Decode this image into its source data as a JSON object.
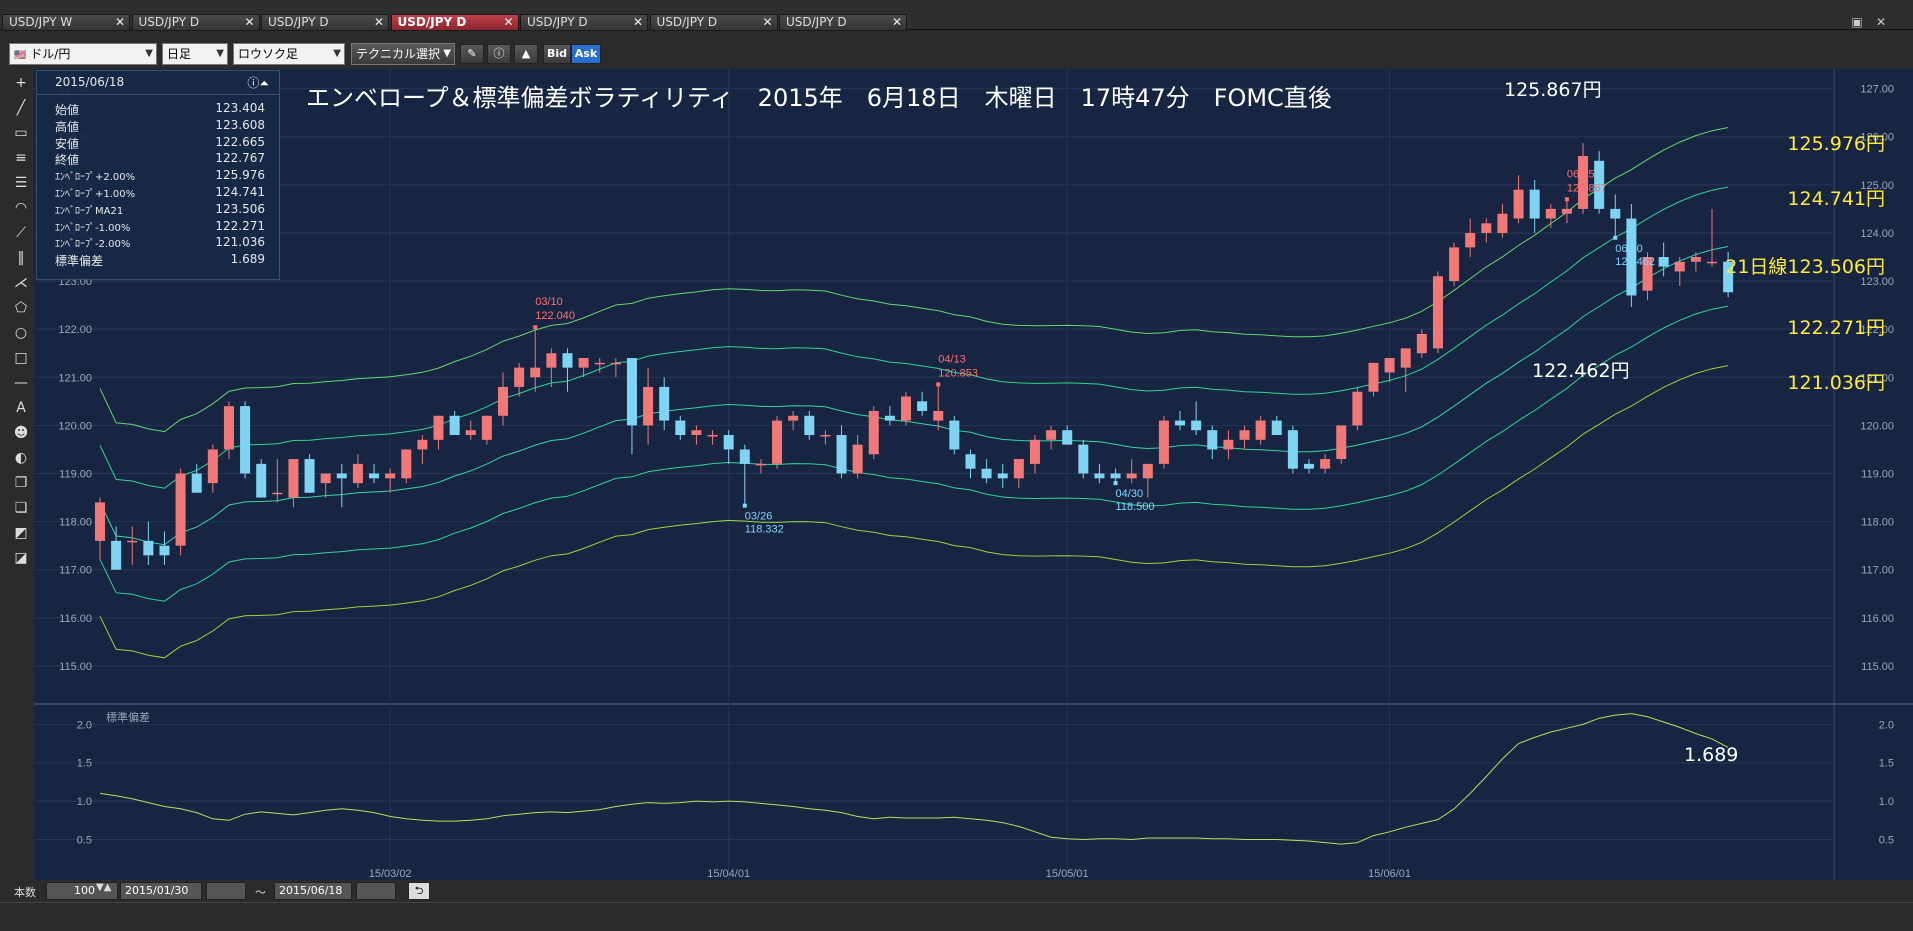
{
  "tabs": [
    {
      "label": "USD/JPY W",
      "active": false
    },
    {
      "label": "USD/JPY D",
      "active": false
    },
    {
      "label": "USD/JPY D",
      "active": false
    },
    {
      "label": "USD/JPY D",
      "active": true
    },
    {
      "label": "USD/JPY D",
      "active": false
    },
    {
      "label": "USD/JPY D",
      "active": false
    },
    {
      "label": "USD/JPY D",
      "active": false
    }
  ],
  "toolbar": {
    "pair": "ドル/円",
    "period": "日足",
    "chart_type": "ロウソク足",
    "technical": "テクニカル選択",
    "bid": "Bid",
    "ask": "Ask"
  },
  "infobox": {
    "date": "2015/06/18",
    "rows": [
      {
        "label": "始値",
        "value": "123.404"
      },
      {
        "label": "高値",
        "value": "123.608"
      },
      {
        "label": "安値",
        "value": "122.665"
      },
      {
        "label": "終値",
        "value": "122.767"
      },
      {
        "label": "ｴﾝﾍﾞﾛｰﾌﾟ+2.00%",
        "value": "125.976"
      },
      {
        "label": "ｴﾝﾍﾞﾛｰﾌﾟ+1.00%",
        "value": "124.741"
      },
      {
        "label": "ｴﾝﾍﾞﾛｰﾌﾟMA21",
        "value": "123.506"
      },
      {
        "label": "ｴﾝﾍﾞﾛｰﾌﾟ-1.00%",
        "value": "122.271"
      },
      {
        "label": "ｴﾝﾍﾞﾛｰﾌﾟ-2.00%",
        "value": "121.036"
      },
      {
        "label": "標準偏差",
        "value": "1.689"
      }
    ]
  },
  "chart_data": {
    "type": "candlestick",
    "title": "エンベロープ＆標準偏差ボラティリティ　2015年　6月18日　木曜日　17時47分　FOMC直後",
    "y_ticks": [
      "127.00",
      "126.00",
      "125.00",
      "124.00",
      "123.00",
      "122.00",
      "121.00",
      "120.00",
      "119.00",
      "118.00",
      "117.00",
      "116.00",
      "115.00"
    ],
    "ylim": [
      114.5,
      127.2
    ],
    "x_date_labels": [
      {
        "label": "15/03/02",
        "index": 18
      },
      {
        "label": "15/04/01",
        "index": 39
      },
      {
        "label": "15/05/01",
        "index": 60
      },
      {
        "label": "15/06/01",
        "index": 80
      }
    ],
    "candles": [
      {
        "o": 117.6,
        "h": 118.5,
        "l": 117.2,
        "c": 118.4
      },
      {
        "o": 117.6,
        "h": 117.9,
        "l": 117.0,
        "c": 117.0
      },
      {
        "o": 117.6,
        "h": 117.9,
        "l": 117.1,
        "c": 117.6
      },
      {
        "o": 117.6,
        "h": 118.0,
        "l": 117.1,
        "c": 117.3
      },
      {
        "o": 117.5,
        "h": 117.8,
        "l": 117.1,
        "c": 117.3
      },
      {
        "o": 117.5,
        "h": 119.1,
        "l": 117.3,
        "c": 119.0
      },
      {
        "o": 119.0,
        "h": 119.2,
        "l": 118.6,
        "c": 118.6
      },
      {
        "o": 118.8,
        "h": 119.6,
        "l": 118.6,
        "c": 119.5
      },
      {
        "o": 119.5,
        "h": 120.5,
        "l": 119.3,
        "c": 120.4
      },
      {
        "o": 120.4,
        "h": 120.5,
        "l": 118.9,
        "c": 119.0
      },
      {
        "o": 119.2,
        "h": 119.3,
        "l": 118.5,
        "c": 118.5
      },
      {
        "o": 118.6,
        "h": 119.3,
        "l": 118.4,
        "c": 118.6
      },
      {
        "o": 118.5,
        "h": 119.3,
        "l": 118.3,
        "c": 119.3
      },
      {
        "o": 119.3,
        "h": 119.4,
        "l": 118.6,
        "c": 118.6
      },
      {
        "o": 118.8,
        "h": 119.0,
        "l": 118.5,
        "c": 119.0
      },
      {
        "o": 119.0,
        "h": 119.2,
        "l": 118.3,
        "c": 118.9
      },
      {
        "o": 118.8,
        "h": 119.4,
        "l": 118.7,
        "c": 119.2
      },
      {
        "o": 119.0,
        "h": 119.2,
        "l": 118.8,
        "c": 118.9
      },
      {
        "o": 118.9,
        "h": 119.1,
        "l": 118.6,
        "c": 119.0
      },
      {
        "o": 118.9,
        "h": 119.5,
        "l": 118.8,
        "c": 119.5
      },
      {
        "o": 119.5,
        "h": 119.8,
        "l": 119.2,
        "c": 119.7
      },
      {
        "o": 119.7,
        "h": 120.2,
        "l": 119.5,
        "c": 120.2
      },
      {
        "o": 120.2,
        "h": 120.3,
        "l": 119.8,
        "c": 119.8
      },
      {
        "o": 119.8,
        "h": 120.1,
        "l": 119.7,
        "c": 119.9
      },
      {
        "o": 119.7,
        "h": 120.2,
        "l": 119.6,
        "c": 120.2
      },
      {
        "o": 120.2,
        "h": 121.1,
        "l": 120.0,
        "c": 120.8
      },
      {
        "o": 120.8,
        "h": 121.3,
        "l": 120.6,
        "c": 121.2
      },
      {
        "o": 121.0,
        "h": 122.04,
        "l": 120.7,
        "c": 121.2
      },
      {
        "o": 121.2,
        "h": 121.6,
        "l": 120.8,
        "c": 121.5
      },
      {
        "o": 121.5,
        "h": 121.6,
        "l": 120.7,
        "c": 121.2
      },
      {
        "o": 121.2,
        "h": 121.4,
        "l": 121.0,
        "c": 121.4
      },
      {
        "o": 121.3,
        "h": 121.4,
        "l": 121.1,
        "c": 121.3
      },
      {
        "o": 121.3,
        "h": 121.4,
        "l": 121.0,
        "c": 121.3
      },
      {
        "o": 121.4,
        "h": 121.4,
        "l": 119.4,
        "c": 120.0
      },
      {
        "o": 120.0,
        "h": 121.2,
        "l": 119.6,
        "c": 120.8
      },
      {
        "o": 120.8,
        "h": 121.0,
        "l": 119.9,
        "c": 120.1
      },
      {
        "o": 120.1,
        "h": 120.2,
        "l": 119.7,
        "c": 119.8
      },
      {
        "o": 119.8,
        "h": 120.0,
        "l": 119.6,
        "c": 119.9
      },
      {
        "o": 119.8,
        "h": 119.9,
        "l": 119.6,
        "c": 119.8
      },
      {
        "o": 119.8,
        "h": 119.9,
        "l": 119.2,
        "c": 119.5
      },
      {
        "o": 119.5,
        "h": 119.6,
        "l": 118.332,
        "c": 119.2
      },
      {
        "o": 119.2,
        "h": 119.3,
        "l": 119.0,
        "c": 119.2
      },
      {
        "o": 119.2,
        "h": 120.2,
        "l": 119.1,
        "c": 120.1
      },
      {
        "o": 120.1,
        "h": 120.3,
        "l": 119.9,
        "c": 120.2
      },
      {
        "o": 120.2,
        "h": 120.3,
        "l": 119.7,
        "c": 119.8
      },
      {
        "o": 119.8,
        "h": 119.9,
        "l": 119.6,
        "c": 119.8
      },
      {
        "o": 119.8,
        "h": 120.0,
        "l": 118.9,
        "c": 119.0
      },
      {
        "o": 119.0,
        "h": 119.8,
        "l": 118.9,
        "c": 119.6
      },
      {
        "o": 119.4,
        "h": 120.4,
        "l": 119.3,
        "c": 120.3
      },
      {
        "o": 120.2,
        "h": 120.4,
        "l": 120.0,
        "c": 120.1
      },
      {
        "o": 120.1,
        "h": 120.7,
        "l": 120.0,
        "c": 120.6
      },
      {
        "o": 120.5,
        "h": 120.7,
        "l": 120.2,
        "c": 120.3
      },
      {
        "o": 120.1,
        "h": 120.853,
        "l": 119.9,
        "c": 120.3
      },
      {
        "o": 120.1,
        "h": 120.2,
        "l": 119.4,
        "c": 119.5
      },
      {
        "o": 119.4,
        "h": 119.5,
        "l": 118.9,
        "c": 119.1
      },
      {
        "o": 119.1,
        "h": 119.3,
        "l": 118.8,
        "c": 118.9
      },
      {
        "o": 119.0,
        "h": 119.2,
        "l": 118.7,
        "c": 118.9
      },
      {
        "o": 118.9,
        "h": 119.3,
        "l": 118.7,
        "c": 119.3
      },
      {
        "o": 119.2,
        "h": 119.8,
        "l": 119.0,
        "c": 119.7
      },
      {
        "o": 119.7,
        "h": 120.0,
        "l": 119.5,
        "c": 119.9
      },
      {
        "o": 119.9,
        "h": 120.0,
        "l": 119.6,
        "c": 119.6
      },
      {
        "o": 119.6,
        "h": 119.7,
        "l": 118.9,
        "c": 119.0
      },
      {
        "o": 119.0,
        "h": 119.2,
        "l": 118.8,
        "c": 118.9
      },
      {
        "o": 119.0,
        "h": 119.1,
        "l": 118.8,
        "c": 118.9
      },
      {
        "o": 118.9,
        "h": 119.3,
        "l": 118.8,
        "c": 119.0
      },
      {
        "o": 118.9,
        "h": 119.2,
        "l": 118.5,
        "c": 119.2
      },
      {
        "o": 119.2,
        "h": 120.2,
        "l": 119.1,
        "c": 120.1
      },
      {
        "o": 120.1,
        "h": 120.3,
        "l": 119.9,
        "c": 120.0
      },
      {
        "o": 120.1,
        "h": 120.5,
        "l": 119.8,
        "c": 119.9
      },
      {
        "o": 119.9,
        "h": 120.0,
        "l": 119.3,
        "c": 119.5
      },
      {
        "o": 119.5,
        "h": 119.9,
        "l": 119.3,
        "c": 119.7
      },
      {
        "o": 119.7,
        "h": 120.0,
        "l": 119.5,
        "c": 119.9
      },
      {
        "o": 119.7,
        "h": 120.2,
        "l": 119.6,
        "c": 120.1
      },
      {
        "o": 120.1,
        "h": 120.2,
        "l": 119.8,
        "c": 119.8
      },
      {
        "o": 119.9,
        "h": 120.0,
        "l": 119.0,
        "c": 119.1
      },
      {
        "o": 119.2,
        "h": 119.3,
        "l": 119.0,
        "c": 119.1
      },
      {
        "o": 119.1,
        "h": 119.4,
        "l": 119.0,
        "c": 119.3
      },
      {
        "o": 119.3,
        "h": 120.0,
        "l": 119.2,
        "c": 120.0
      },
      {
        "o": 120.0,
        "h": 120.8,
        "l": 119.9,
        "c": 120.7
      },
      {
        "o": 120.7,
        "h": 121.3,
        "l": 120.6,
        "c": 121.3
      },
      {
        "o": 121.1,
        "h": 121.4,
        "l": 120.9,
        "c": 121.4
      },
      {
        "o": 121.2,
        "h": 121.6,
        "l": 120.7,
        "c": 121.6
      },
      {
        "o": 121.5,
        "h": 122.0,
        "l": 121.4,
        "c": 121.9
      },
      {
        "o": 121.6,
        "h": 123.2,
        "l": 121.5,
        "c": 123.1
      },
      {
        "o": 123.0,
        "h": 123.8,
        "l": 122.9,
        "c": 123.7
      },
      {
        "o": 123.7,
        "h": 124.3,
        "l": 123.5,
        "c": 124.0
      },
      {
        "o": 124.0,
        "h": 124.3,
        "l": 123.8,
        "c": 124.2
      },
      {
        "o": 124.0,
        "h": 124.6,
        "l": 123.9,
        "c": 124.4
      },
      {
        "o": 124.3,
        "h": 125.2,
        "l": 124.2,
        "c": 124.9
      },
      {
        "o": 124.9,
        "h": 125.1,
        "l": 124.0,
        "c": 124.3
      },
      {
        "o": 124.3,
        "h": 124.6,
        "l": 124.1,
        "c": 124.5
      },
      {
        "o": 124.4,
        "h": 124.7,
        "l": 124.2,
        "c": 124.5
      },
      {
        "o": 124.5,
        "h": 125.867,
        "l": 124.4,
        "c": 125.6
      },
      {
        "o": 125.5,
        "h": 125.7,
        "l": 124.4,
        "c": 124.5
      },
      {
        "o": 124.5,
        "h": 124.8,
        "l": 123.9,
        "c": 124.3
      },
      {
        "o": 124.3,
        "h": 124.6,
        "l": 122.462,
        "c": 122.7
      },
      {
        "o": 122.8,
        "h": 123.6,
        "l": 122.6,
        "c": 123.5
      },
      {
        "o": 123.5,
        "h": 123.8,
        "l": 123.1,
        "c": 123.3
      },
      {
        "o": 123.2,
        "h": 123.5,
        "l": 122.9,
        "c": 123.4
      },
      {
        "o": 123.4,
        "h": 123.6,
        "l": 123.2,
        "c": 123.5
      },
      {
        "o": 123.4,
        "h": 124.5,
        "l": 123.3,
        "c": 123.4
      },
      {
        "o": 123.404,
        "h": 123.608,
        "l": 122.665,
        "c": 122.767
      }
    ],
    "annotations": [
      {
        "index": 27,
        "date": "03/10",
        "value": "122.040",
        "pos": "high",
        "color": "#ff6f6f"
      },
      {
        "index": 40,
        "date": "03/26",
        "value": "118.332",
        "pos": "low",
        "color": "#7fd8ff"
      },
      {
        "index": 52,
        "date": "04/13",
        "value": "120.853",
        "pos": "high",
        "color": "#ff6f6f"
      },
      {
        "index": 63,
        "date": "04/30",
        "value": "118.500",
        "pos": "low",
        "color": "#7fd8ff"
      },
      {
        "index": 91,
        "date": "06/05",
        "value": "125.867",
        "pos": "high",
        "color": "#ff6f6f"
      },
      {
        "index": 94,
        "date": "06/10",
        "value": "122.462",
        "pos": "low",
        "color": "#7fd8ff"
      }
    ],
    "overlay_labels": [
      {
        "text": "125.867円",
        "color": "#ffffff"
      },
      {
        "text": "122.462円",
        "color": "#ffffff"
      },
      {
        "text": "125.976円",
        "color": "#ffeb3b"
      },
      {
        "text": "124.741円",
        "color": "#ffeb3b"
      },
      {
        "text": "21日線123.506円",
        "color": "#ffeb3b"
      },
      {
        "text": "122.271円",
        "color": "#ffeb3b"
      },
      {
        "text": "121.036円",
        "color": "#ffeb3b"
      }
    ],
    "sub": {
      "title": "標準偏差",
      "y_ticks": [
        "2.0",
        "1.5",
        "1.0",
        "0.5"
      ],
      "ylim": [
        0.35,
        2.2
      ],
      "last_label": "1.689",
      "values": [
        1.1,
        1.07,
        1.03,
        0.98,
        0.93,
        0.9,
        0.85,
        0.77,
        0.75,
        0.83,
        0.86,
        0.84,
        0.82,
        0.85,
        0.88,
        0.9,
        0.88,
        0.85,
        0.8,
        0.77,
        0.75,
        0.74,
        0.74,
        0.75,
        0.77,
        0.81,
        0.83,
        0.85,
        0.86,
        0.85,
        0.87,
        0.89,
        0.93,
        0.96,
        0.98,
        0.97,
        0.98,
        1.0,
        0.99,
        1.0,
        0.99,
        0.97,
        0.95,
        0.93,
        0.9,
        0.88,
        0.85,
        0.8,
        0.77,
        0.79,
        0.78,
        0.78,
        0.78,
        0.79,
        0.77,
        0.75,
        0.72,
        0.67,
        0.6,
        0.53,
        0.51,
        0.5,
        0.51,
        0.51,
        0.5,
        0.52,
        0.52,
        0.52,
        0.52,
        0.51,
        0.51,
        0.5,
        0.5,
        0.5,
        0.49,
        0.48,
        0.46,
        0.44,
        0.46,
        0.55,
        0.6,
        0.66,
        0.71,
        0.76,
        0.9,
        1.1,
        1.32,
        1.55,
        1.75,
        1.83,
        1.9,
        1.95,
        2.0,
        2.08,
        2.12,
        2.14,
        2.1,
        2.03,
        1.96,
        1.88,
        1.81,
        1.7
      ]
    }
  },
  "bottom": {
    "count_label": "本数",
    "count_value": "100",
    "from_date": "2015/01/30",
    "tilde": "〜",
    "to_date": "2015/06/18"
  }
}
